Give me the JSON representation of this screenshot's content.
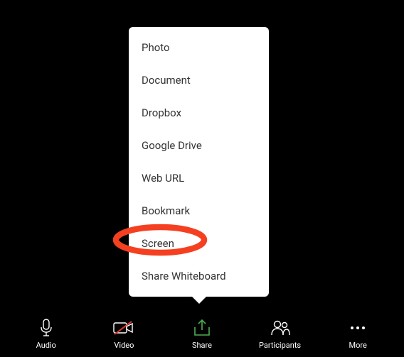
{
  "shareMenu": {
    "items": [
      "Photo",
      "Document",
      "Dropbox",
      "Google Drive",
      "Web URL",
      "Bookmark",
      "Screen",
      "Share Whiteboard"
    ]
  },
  "toolbar": {
    "audio": "Audio",
    "video": "Video",
    "share": "Share",
    "participants": "Participants",
    "more": "More"
  },
  "highlight": {
    "color": "#f44021",
    "target": "Screen"
  }
}
